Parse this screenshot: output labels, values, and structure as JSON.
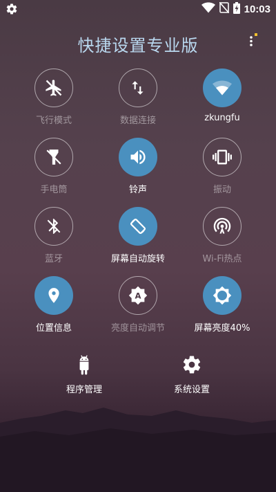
{
  "status_bar": {
    "time": "10:03",
    "icons": [
      "settings-gear-icon",
      "wifi-icon",
      "no-sim-icon",
      "battery-charging-icon"
    ]
  },
  "header": {
    "title": "快捷设置专业版",
    "menu_icon": "overflow-menu-icon"
  },
  "tiles": [
    {
      "label": "飞行模式",
      "icon": "airplane-icon",
      "active": false
    },
    {
      "label": "数据连接",
      "icon": "data-transfer-icon",
      "active": false
    },
    {
      "label": "zkungfu",
      "icon": "wifi-icon",
      "active": true
    },
    {
      "label": "手电筒",
      "icon": "flashlight-icon",
      "active": false
    },
    {
      "label": "铃声",
      "icon": "volume-icon",
      "active": true
    },
    {
      "label": "振动",
      "icon": "vibrate-icon",
      "active": false
    },
    {
      "label": "蓝牙",
      "icon": "bluetooth-icon",
      "active": false
    },
    {
      "label": "屏幕自动旋转",
      "icon": "screen-rotation-icon",
      "active": true
    },
    {
      "label": "Wi-Fi热点",
      "icon": "hotspot-icon",
      "active": false
    },
    {
      "label": "位置信息",
      "icon": "location-icon",
      "active": true
    },
    {
      "label": "亮度自动调节",
      "icon": "auto-brightness-icon",
      "active": false
    },
    {
      "label": "屏幕亮度40%",
      "icon": "brightness-icon",
      "active": true
    }
  ],
  "bottom_actions": [
    {
      "label": "程序管理",
      "icon": "android-icon"
    },
    {
      "label": "系统设置",
      "icon": "gear-icon"
    }
  ],
  "colors": {
    "active": "#4a90bf",
    "title": "#b9d8ef",
    "accent_dot": "#f2c12e"
  }
}
